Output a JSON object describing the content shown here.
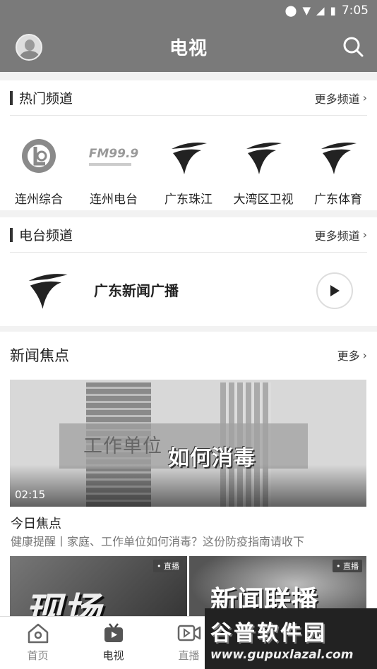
{
  "status_bar": {
    "time": "7:05"
  },
  "header": {
    "title": "电视"
  },
  "hot_channels": {
    "title": "热门频道",
    "more": "更多频道",
    "items": [
      {
        "name": "连州综合",
        "icon": "lianzhou-logo"
      },
      {
        "name": "连州电台",
        "icon": "fm-logo",
        "logo_text": "FM99.9"
      },
      {
        "name": "广东珠江",
        "icon": "gdtv-logo"
      },
      {
        "name": "大湾区卫视",
        "icon": "gdtv-logo"
      },
      {
        "name": "广东体育",
        "icon": "gdtv-logo"
      }
    ]
  },
  "radio_channels": {
    "title": "电台频道",
    "more": "更多频道",
    "item": {
      "name": "广东新闻广播",
      "icon": "gdtv-logo"
    }
  },
  "news_focus": {
    "title": "新闻焦点",
    "more": "更多",
    "featured": {
      "caption_line1": "工作单位",
      "caption_line2": "如何消毒",
      "duration": "02:15",
      "title": "今日焦点",
      "subtitle": "健康提醒丨家庭、工作单位如何消毒？这份防疫指南请收下"
    },
    "thumbnails": [
      {
        "badge": "• 直播",
        "text": "现场"
      },
      {
        "badge": "• 直播",
        "text": "新闻联播"
      }
    ]
  },
  "tabbar": {
    "items": [
      {
        "label": "首页",
        "icon": "home-icon"
      },
      {
        "label": "电视",
        "icon": "tv-icon",
        "active": true
      },
      {
        "label": "直播",
        "icon": "live-video-icon"
      }
    ]
  },
  "watermark": {
    "main": "谷普软件园",
    "url": "www.gupuxlazal.com"
  }
}
